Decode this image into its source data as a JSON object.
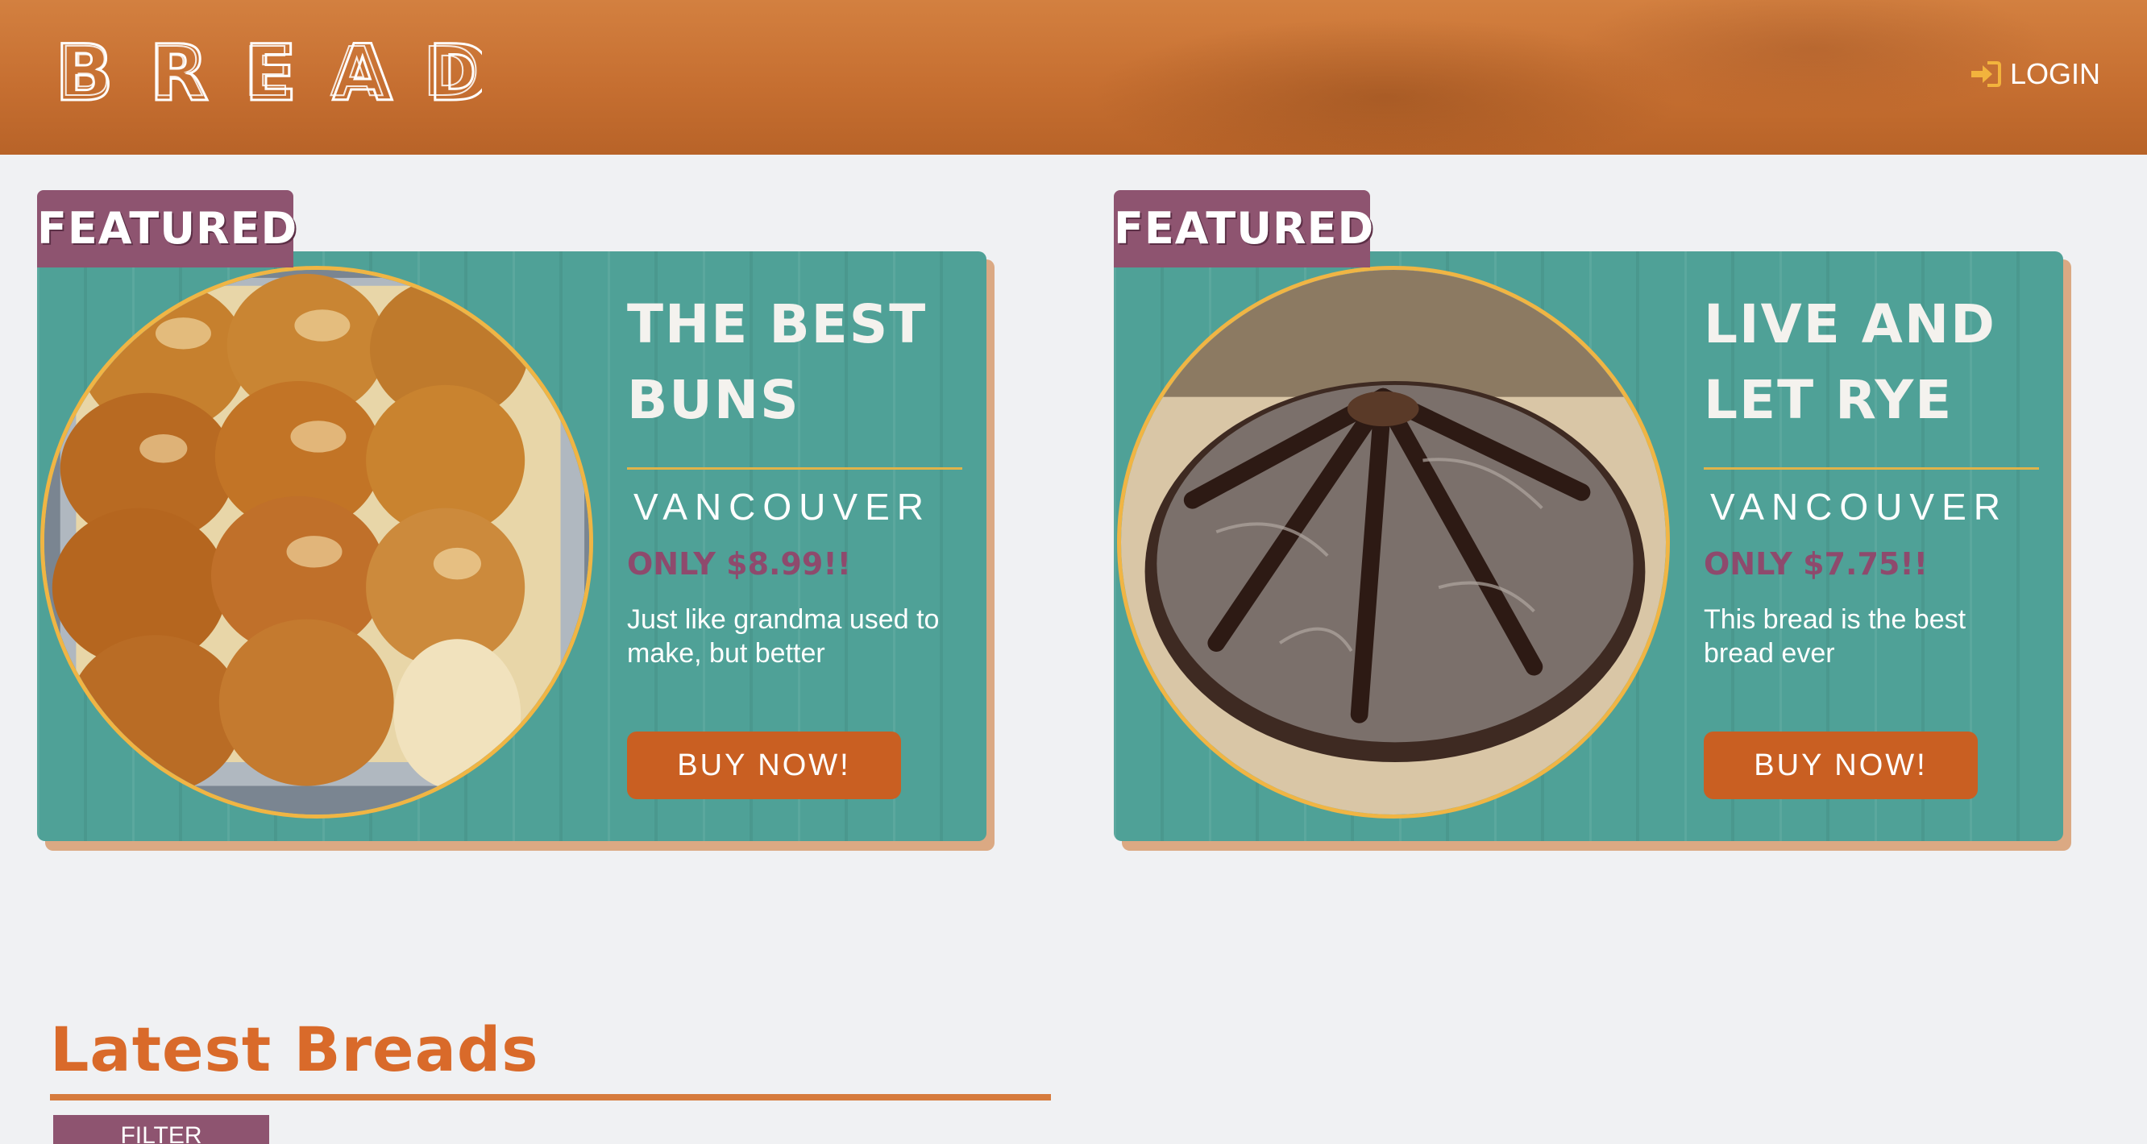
{
  "header": {
    "logo_text": "BREAD",
    "login_label": "LOGIN",
    "login_icon": "sign-in-icon"
  },
  "featured": [
    {
      "tag": "FEATURED",
      "title_line1": "THE BEST",
      "title_line2": "BUNS",
      "location": "VANCOUVER",
      "price": "ONLY $8.99!!",
      "description": "Just like grandma used to make, but better",
      "button_label": "BUY NOW!",
      "image": "buns-in-tray-photo"
    },
    {
      "tag": "FEATURED",
      "title_line1": "LIVE AND",
      "title_line2": "LET RYE",
      "location": "VANCOUVER",
      "price": "ONLY $7.75!!",
      "description": "This bread is the best bread ever",
      "button_label": "BUY NOW!",
      "image": "rye-loaf-photo"
    }
  ],
  "latest": {
    "title": "Latest Breads",
    "filter_label": "FILTER"
  },
  "colors": {
    "header": "#c66f31",
    "card_teal": "#4fa197",
    "featured_purple": "#8e5470",
    "button_orange": "#c95f22",
    "accent_gold": "#f0b544",
    "latest_orange": "#d96a2a"
  }
}
